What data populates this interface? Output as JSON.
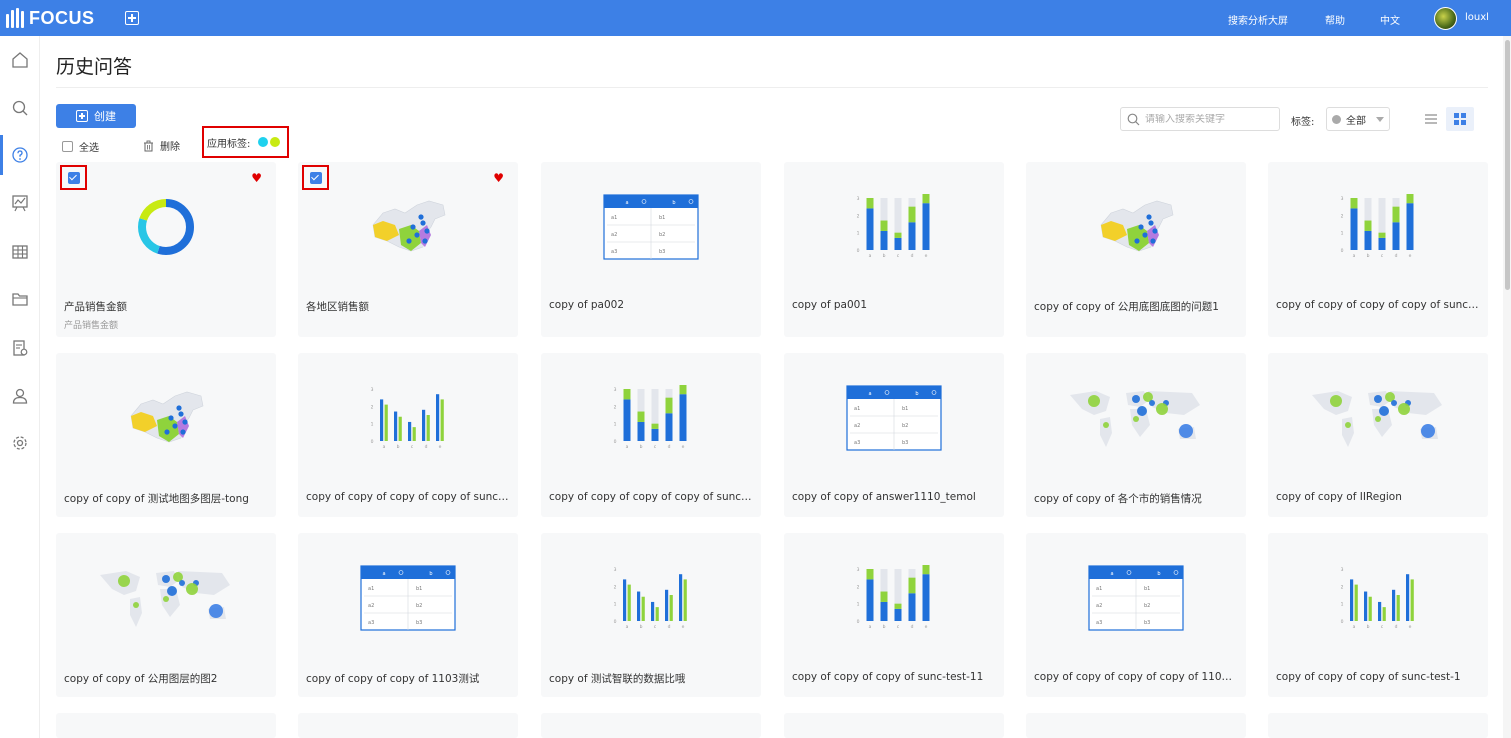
{
  "app": {
    "logo_text": "FOCUS"
  },
  "topbar": {
    "links": [
      "搜索分析大屏",
      "帮助",
      "中文"
    ],
    "username": "louxl"
  },
  "page": {
    "title": "历史问答"
  },
  "toolbar": {
    "create_label": "创建",
    "select_all_label": "全选",
    "delete_label": "删除",
    "apply_tag_label": "应用标签:",
    "apply_tag_colors": [
      "#1fd1ee",
      "#c8ea12"
    ],
    "search_placeholder": "请输入搜索关键字",
    "tag_filter_label": "标签:",
    "tag_filter_value": "全部"
  },
  "colors": {
    "accent": "#3d80e6",
    "highlight": "#e00000",
    "bar_blue": "#1f6fd9",
    "bar_green": "#8fd33c",
    "bar_gray": "#e3e6ec"
  },
  "cards": [
    {
      "title": "产品销售金额",
      "subtitle": "产品销售金额",
      "thumb": "donut-chart",
      "checked": true,
      "favorite": true
    },
    {
      "title": "各地区销售额",
      "thumb": "china-map",
      "checked": true,
      "favorite": true
    },
    {
      "title": "copy of pa002",
      "thumb": "table"
    },
    {
      "title": "copy of pa001",
      "thumb": "stacked-bar"
    },
    {
      "title": "copy of copy of 公用底图底图的问题1",
      "thumb": "china-map"
    },
    {
      "title": "copy of copy of copy of copy of sunc-t...",
      "thumb": "stacked-bar"
    },
    {
      "title": "copy of copy of 测试地图多图层-tong",
      "thumb": "china-map"
    },
    {
      "title": "copy of copy of copy of copy of sunc-t...",
      "thumb": "grouped-bar"
    },
    {
      "title": "copy of copy of copy of copy of sunc-t...",
      "thumb": "stacked-bar"
    },
    {
      "title": "copy of copy of answer1110_temol",
      "thumb": "table"
    },
    {
      "title": "copy of copy of 各个市的销售情况",
      "thumb": "world-map"
    },
    {
      "title": "copy of copy of IIRegion",
      "thumb": "world-map"
    },
    {
      "title": "copy of copy of 公用图层的图2",
      "thumb": "world-map"
    },
    {
      "title": "copy of copy of copy of 1103测试",
      "thumb": "table"
    },
    {
      "title": "copy of 测试智联的数据比哦",
      "thumb": "grouped-bar"
    },
    {
      "title": "copy of copy of copy of sunc-test-11",
      "thumb": "stacked-bar"
    },
    {
      "title": "copy of copy of copy of copy of 1103...",
      "thumb": "table"
    },
    {
      "title": "copy of copy of copy of sunc-test-1",
      "thumb": "grouped-bar"
    }
  ],
  "thumb_table": {
    "headers": [
      "a",
      "b"
    ],
    "rows": [
      [
        "a1",
        "b1"
      ],
      [
        "a2",
        "b2"
      ],
      [
        "a3",
        "b3"
      ]
    ]
  },
  "thumb_stacked_bar": {
    "axis_ticks": [
      "3",
      "2",
      "1",
      "0"
    ],
    "categories": [
      "a",
      "b",
      "c",
      "d",
      "e"
    ],
    "blue": [
      2.4,
      1.1,
      0.7,
      1.6,
      2.7
    ],
    "green": [
      0.6,
      0.6,
      0.3,
      0.9,
      0.6
    ]
  },
  "thumb_grouped_bar": {
    "axis_ticks": [
      "3",
      "2",
      "1",
      "0"
    ],
    "categories": [
      "a",
      "b",
      "c",
      "d",
      "e"
    ],
    "blue": [
      2.4,
      1.7,
      1.1,
      1.8,
      2.7
    ],
    "green": [
      2.1,
      1.4,
      0.8,
      1.5,
      2.4
    ]
  }
}
